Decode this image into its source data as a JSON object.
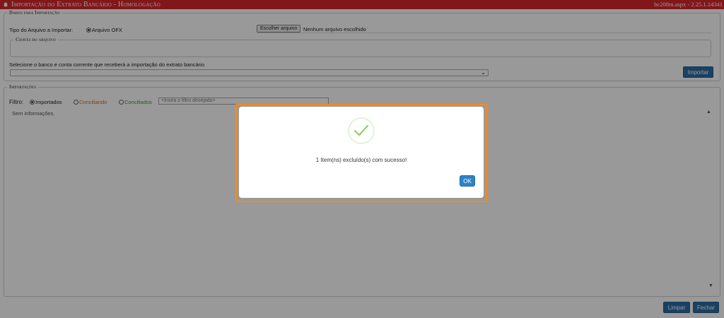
{
  "header": {
    "title": "Importação do Extrato Bancário - Homologação",
    "version": "bc208m.aspx - 2.25.1.14341"
  },
  "dados": {
    "legend": "Dados para Importação",
    "tipo_label": "Tipo do Arquivo a Importar:",
    "tipo_option": "Arquivo OFX",
    "file_button": "Escolher arquivo",
    "file_status": "Nenhum arquivo escolhido",
    "chaves_legend": "Chaves do arquivo",
    "select_label": "Selecione o banco e conta corrente que receberá a importação do extrato bancário",
    "select_value": "",
    "import_button": "Importar"
  },
  "importacoes": {
    "legend": "Importações",
    "filter_label": "Filtro:",
    "filter_options": [
      {
        "label": "Importados",
        "color": "#222222",
        "selected": true
      },
      {
        "label": "Conciliando",
        "color": "#e0661a",
        "selected": false
      },
      {
        "label": "Conciliados",
        "color": "#3d9a3d",
        "selected": false
      }
    ],
    "filter_placeholder": "<Insira o filtro desejado>",
    "empty_text": "Sem informações."
  },
  "footer": {
    "limpar": "Limpar",
    "fechar": "Fechar"
  },
  "modal": {
    "icon": "success-check-icon",
    "message": "1 Item(ns) excluído(s) com sucesso!",
    "ok": "OK"
  },
  "colors": {
    "header_bg": "#d9272e",
    "button_blue": "#2e6da4",
    "highlight": "#f28c1e"
  }
}
